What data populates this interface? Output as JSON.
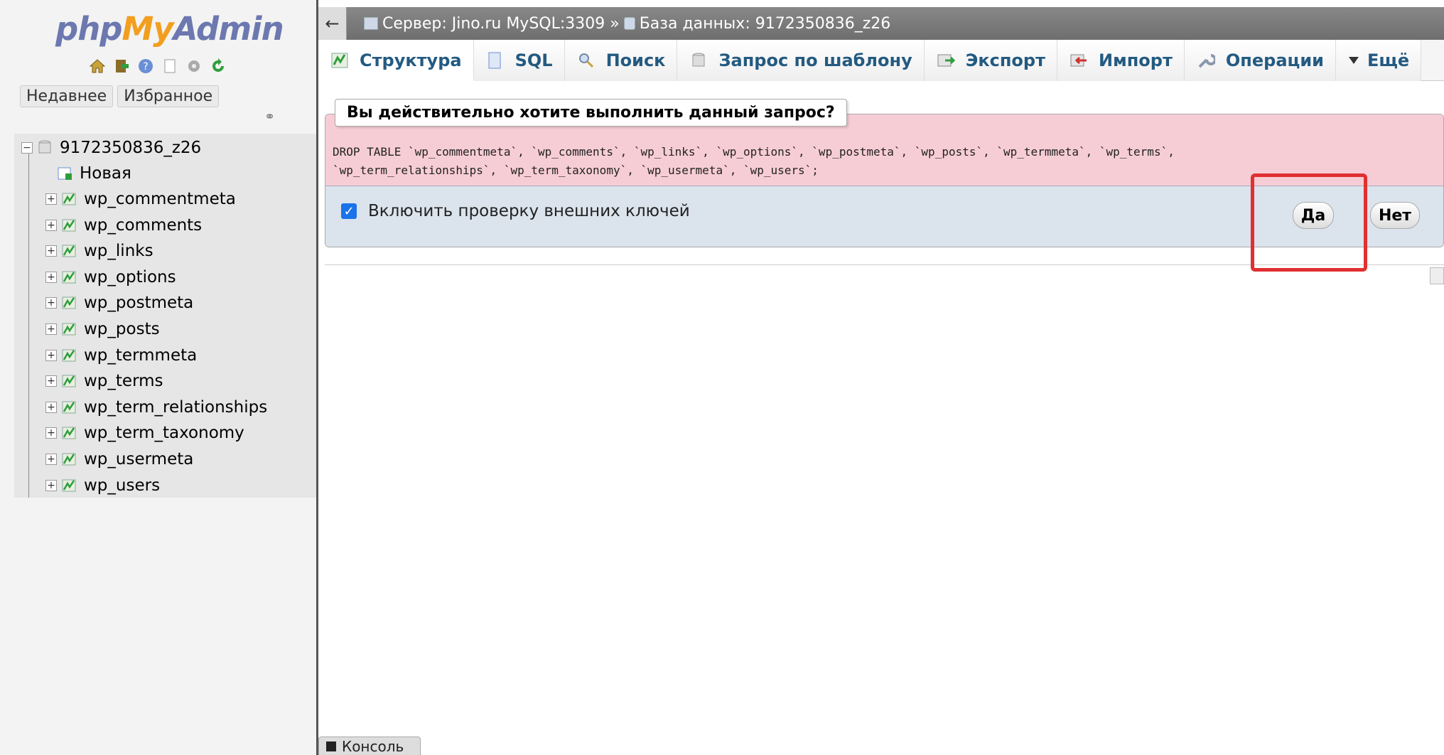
{
  "nav": {
    "logo": {
      "php": "php",
      "my": "My",
      "admin": "Admin"
    },
    "tabs": [
      "Недавнее",
      "Избранное"
    ],
    "tree": {
      "database": "9172350836_z26",
      "new_label": "Новая",
      "tables": [
        "wp_commentmeta",
        "wp_comments",
        "wp_links",
        "wp_options",
        "wp_postmeta",
        "wp_posts",
        "wp_termmeta",
        "wp_terms",
        "wp_term_relationships",
        "wp_term_taxonomy",
        "wp_usermeta",
        "wp_users"
      ]
    }
  },
  "topbar": {
    "back": "←",
    "server": "Сервер: Jino.ru MySQL:3309 »",
    "database": "База данных: 9172350836_z26"
  },
  "tabs": [
    {
      "label": "Структура",
      "icon": "structure-icon"
    },
    {
      "label": "SQL",
      "icon": "sql-icon"
    },
    {
      "label": "Поиск",
      "icon": "search-icon"
    },
    {
      "label": "Запрос по шаблону",
      "icon": "query-icon"
    },
    {
      "label": "Экспорт",
      "icon": "export-icon"
    },
    {
      "label": "Импорт",
      "icon": "import-icon"
    },
    {
      "label": "Операции",
      "icon": "wrench-icon"
    },
    {
      "label": "Ещё",
      "icon": "triangle-down-icon"
    }
  ],
  "confirm": {
    "question": "Вы действительно хотите выполнить данный запрос?",
    "sql": "DROP TABLE `wp_commentmeta`, `wp_comments`, `wp_links`, `wp_options`, `wp_postmeta`, `wp_posts`, `wp_termmeta`, `wp_terms`,\n`wp_term_relationships`, `wp_term_taxonomy`, `wp_usermeta`, `wp_users`;",
    "fk_label": "Включить проверку внешних ключей",
    "fk_checked": true,
    "yes": "Да",
    "no": "Нет"
  },
  "console": "Консоль",
  "colors": {
    "accent_blue": "#235a81",
    "sql_bg": "#f7cdd5",
    "highlight": "#e03030"
  }
}
